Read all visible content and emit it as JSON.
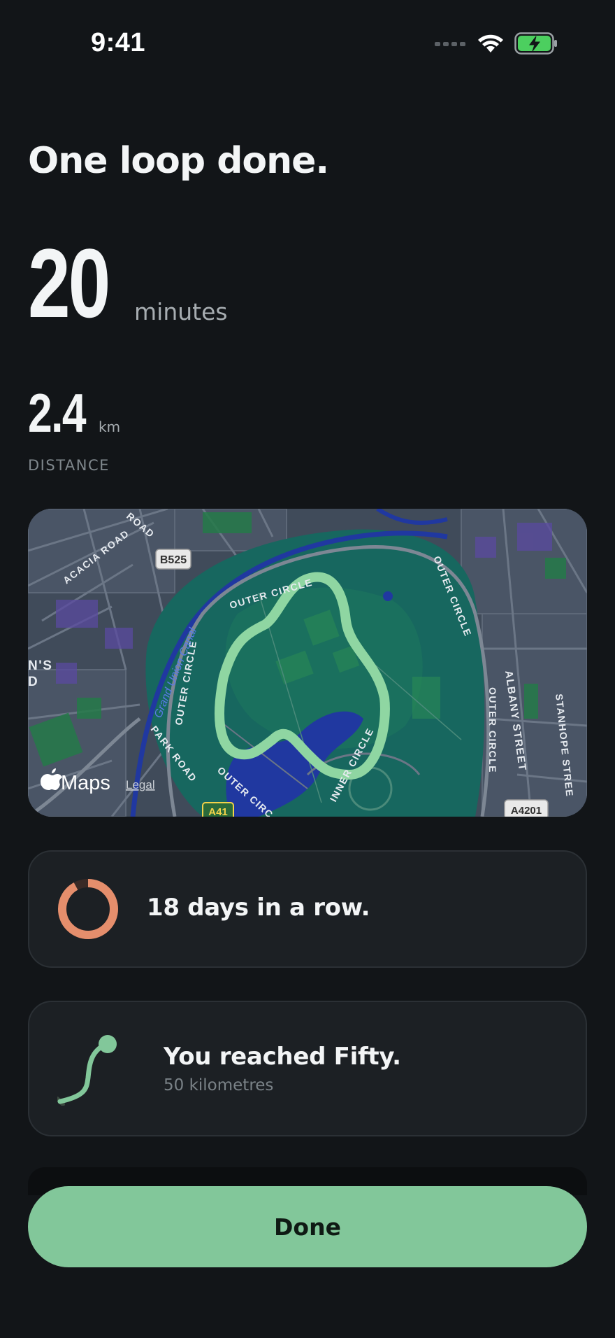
{
  "status_bar": {
    "time": "9:41"
  },
  "headline": "One loop done.",
  "duration": {
    "value": "20",
    "unit": "minutes"
  },
  "distance": {
    "value": "2.4",
    "unit": "km",
    "label": "DISTANCE"
  },
  "map": {
    "attribution_logo": "Maps",
    "legal_link": "Legal",
    "road_labels": {
      "acacia_road": "ACACIA ROAD",
      "road_top": "ROAD",
      "b525": "B525",
      "outer_circle_top": "OUTER CIRCLE",
      "outer_circle_right": "OUTER CIRCLE",
      "outer_circle_left": "OUTER CIRCLE",
      "outer_circle_far_right": "OUTER CIRCLE",
      "outer_circle_bottom": "OUTER CIRC",
      "grand_union_canal": "Grand Union Canal",
      "park_road": "PARK ROAD",
      "inner_circle": "INNER CIRCLE",
      "albany_street": "ALBANY STREET",
      "stanhope_street": "STANHOPE STREE",
      "a41": "A41",
      "a4201": "A4201",
      "ns": "N'S",
      "d": "D"
    },
    "colors": {
      "route": "#8fd6a2",
      "park": "#17675f",
      "water": "#2038a0"
    }
  },
  "streak": {
    "text": "18 days in a row.",
    "progress": 0.92,
    "color": "#e58e6c"
  },
  "milestone": {
    "title": "You reached Fifty.",
    "subtitle": "50 kilometres",
    "color": "#82c79a"
  },
  "done_button": {
    "label": "Done",
    "color": "#82c79a"
  }
}
